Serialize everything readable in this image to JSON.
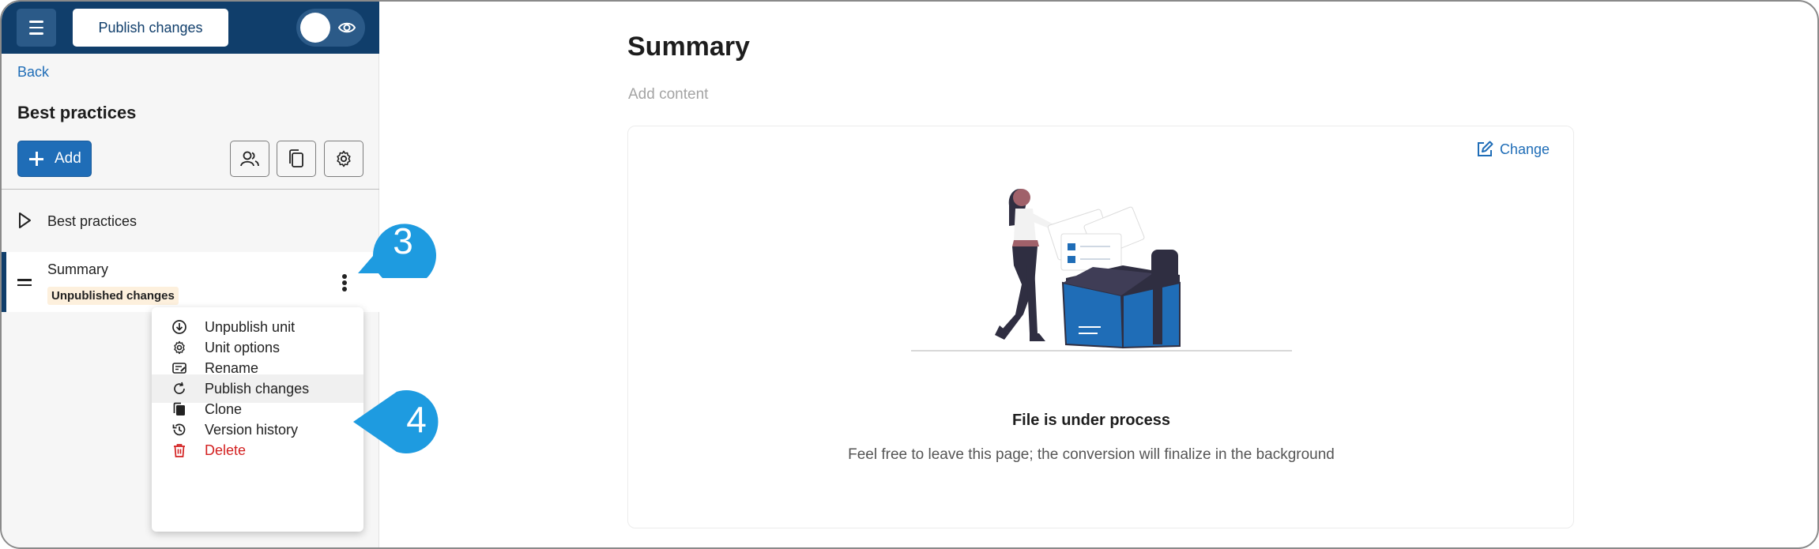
{
  "topbar": {
    "publish_label": "Publish changes"
  },
  "sidebar": {
    "back_label": "Back",
    "course_title": "Best practices",
    "add_label": "Add",
    "tree": [
      {
        "label": "Best practices"
      }
    ],
    "active_unit": {
      "name": "Summary",
      "badge": "Unpublished changes"
    }
  },
  "context_menu": {
    "items": [
      {
        "label": "Unpublish unit",
        "icon": "download-circle-icon"
      },
      {
        "label": "Unit options",
        "icon": "gear-icon"
      },
      {
        "label": "Rename",
        "icon": "rename-icon"
      },
      {
        "label": "Publish changes",
        "icon": "refresh-icon",
        "highlighted": true
      },
      {
        "label": "Clone",
        "icon": "copy-icon"
      },
      {
        "label": "Version history",
        "icon": "history-icon"
      },
      {
        "label": "Delete",
        "icon": "trash-icon",
        "color": "#d32020"
      }
    ]
  },
  "callouts": {
    "step_a": "3",
    "step_b": "4",
    "color": "#1e9be0"
  },
  "main": {
    "title": "Summary",
    "add_content": "Add content",
    "change_label": "Change",
    "processing_title": "File is under process",
    "processing_subtitle": "Feel free to leave this page; the conversion will finalize in the background"
  },
  "colors": {
    "topbar": "#103e6b",
    "primary": "#1f6db7",
    "badge_bg": "#fdf0dd",
    "danger": "#d32020"
  }
}
